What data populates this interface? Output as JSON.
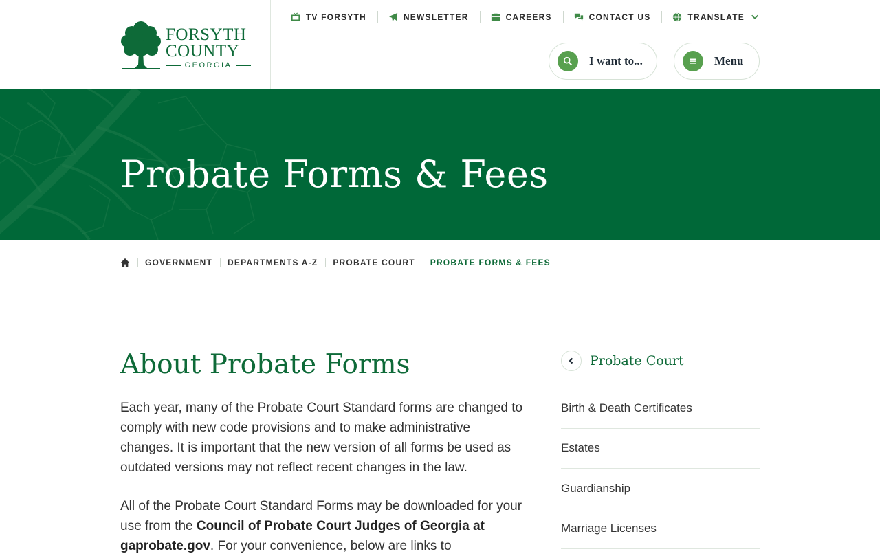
{
  "logo": {
    "line1": "FORSYTH",
    "line2": "COUNTY",
    "line3": "GEORGIA"
  },
  "utility_nav": [
    {
      "label": "TV FORSYTH",
      "icon": "tv-icon"
    },
    {
      "label": "NEWSLETTER",
      "icon": "paper-plane-icon"
    },
    {
      "label": "CAREERS",
      "icon": "briefcase-icon"
    },
    {
      "label": "CONTACT US",
      "icon": "chat-bubbles-icon"
    },
    {
      "label": "TRANSLATE",
      "icon": "globe-icon"
    }
  ],
  "header_buttons": {
    "i_want_to": "I want to...",
    "menu": "Menu"
  },
  "hero": {
    "title": "Probate Forms & Fees"
  },
  "breadcrumb": [
    "GOVERNMENT",
    "DEPARTMENTS A-Z",
    "PROBATE COURT",
    "PROBATE FORMS & FEES"
  ],
  "main": {
    "title": "About Probate Forms",
    "para1": "Each year, many of the Probate Court Standard forms are changed to comply with new code provisions and to make administrative changes. It is important that the new version of all forms be used as outdated versions may not reflect recent changes in the law.",
    "para2_pre": "All of the Probate Court Standard Forms may be downloaded for your use from the ",
    "para2_link": "Council of Probate Court Judges of Georgia at gaprobate.gov",
    "para2_post": ". For your convenience, below are links to"
  },
  "sidebar": {
    "title": "Probate Court",
    "items": [
      "Birth & Death Certificates",
      "Estates",
      "Guardianship",
      "Marriage Licenses"
    ]
  },
  "colors": {
    "brand_green": "#006838",
    "text_green": "#0e6a38",
    "accent_green": "#58a04f"
  }
}
